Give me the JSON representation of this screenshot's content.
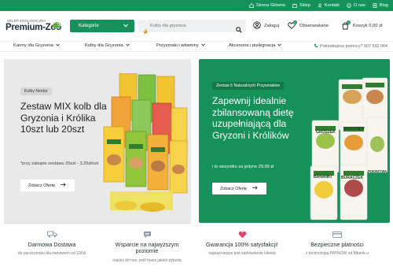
{
  "topbar": {
    "links": [
      {
        "label": "Strona Główna",
        "icon": "home-icon"
      },
      {
        "label": "Sklep",
        "icon": "shop-icon"
      },
      {
        "label": "Kontakt",
        "icon": "contact-icon"
      },
      {
        "label": "O nas",
        "icon": "info-icon"
      },
      {
        "label": "Blog",
        "icon": "blog-icon"
      }
    ]
  },
  "header": {
    "logo_tagline": "SKLEP ZOOLOGICZNY",
    "logo_name": "Premium-Zoo",
    "categories_label": "Kategorie",
    "search_placeholder": "Kolby dla gryzonia",
    "login_label": "Zaloguj",
    "favorites_label": "Obserwowane",
    "favorites_count": "0",
    "cart_label": "Koszyk 0,00 zł",
    "cart_count": "0"
  },
  "nav": {
    "items": [
      "Karmy dla Gryzonia",
      "Kolby dla Gryzonia",
      "Przysmaki i witaminy",
      "Akcesoria i pielęgnacja"
    ],
    "help": "Potrzebujesz pomocy? 607 532 064"
  },
  "banner_left": {
    "chip": "Kolby Nestor",
    "title": "Zestaw MIX kolb dla Gryzonia i Królika 10szt lub 20szt",
    "subtitle": "*przy zakupie zestawu 20szt - 3,25zł/szt",
    "cta": "Zobacz Ofertę"
  },
  "banner_right": {
    "chip": "Zestaw 5 Naturalnych Przysmaków",
    "title": "Zapewnij idealnie zbilansowaną dietę uzupełniającą dla Gryzoni i Królików",
    "subtitle": "i to wszystko za jedyne 29,99 zł",
    "cta": "Zobacz Ofertę",
    "packs": [
      "GROSZEK",
      "MARCHEW",
      "BANANKI",
      "BURACZEK",
      "POKRZYWA"
    ]
  },
  "features": [
    {
      "title": "Darmowa Dostawa",
      "desc": "do paczkomatu dla zamówień od 100zł",
      "icon": "truck-icon"
    },
    {
      "title": "Wsparcie na najwyższym poziomie",
      "desc": "napisz do nas, jeśli masz jakieś pytania",
      "icon": "chat-icon"
    },
    {
      "title": "Gwarancja 100% satysfakcji!",
      "desc": "najważniejsze jest zadowolenie klienta",
      "icon": "heart-icon"
    },
    {
      "title": "Bezpieczne płatności",
      "desc": "z technologią PAYNOW od Mbank-u",
      "icon": "payment-icon"
    }
  ],
  "colors": {
    "brand": "#16915a",
    "text": "#2b2b2b"
  }
}
